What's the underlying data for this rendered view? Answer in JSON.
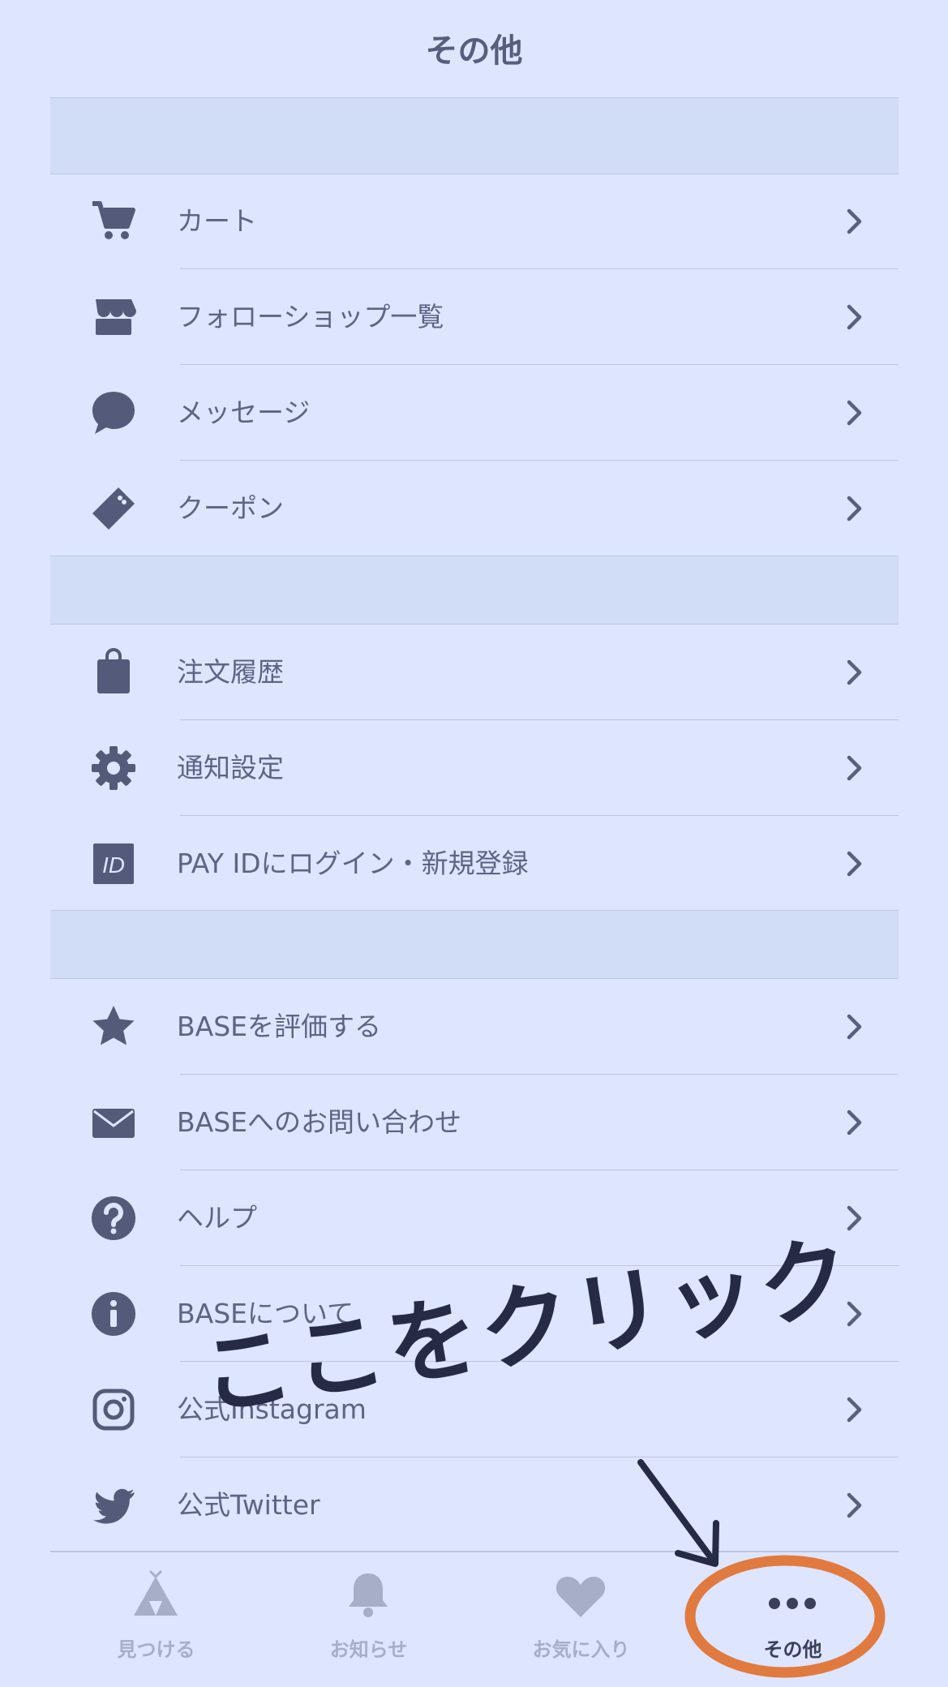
{
  "header": {
    "title": "その他"
  },
  "group1": [
    {
      "label": "カート",
      "icon": "cart-icon"
    },
    {
      "label": "フォローショップ一覧",
      "icon": "shop-icon"
    },
    {
      "label": "メッセージ",
      "icon": "message-icon"
    },
    {
      "label": "クーポン",
      "icon": "coupon-icon"
    }
  ],
  "group2": [
    {
      "label": "注文履歴",
      "icon": "bag-icon"
    },
    {
      "label": "通知設定",
      "icon": "gear-icon"
    },
    {
      "label": "PAY IDにログイン・新規登録",
      "icon": "id-icon",
      "icon_text": "ID"
    }
  ],
  "group3": [
    {
      "label": "BASEを評価する",
      "icon": "star-icon"
    },
    {
      "label": "BASEへのお問い合わせ",
      "icon": "mail-icon"
    },
    {
      "label": "ヘルプ",
      "icon": "help-icon"
    },
    {
      "label": "BASEについて",
      "icon": "info-icon"
    },
    {
      "label": "公式Instagram",
      "icon": "instagram-icon"
    },
    {
      "label": "公式Twitter",
      "icon": "twitter-icon"
    }
  ],
  "tabbar": {
    "tabs": [
      {
        "label": "見つける",
        "icon": "tent-icon",
        "active": false
      },
      {
        "label": "お知らせ",
        "icon": "bell-icon",
        "active": false
      },
      {
        "label": "お気に入り",
        "icon": "heart-icon",
        "active": false
      },
      {
        "label": "その他",
        "icon": "more-icon",
        "active": true
      }
    ]
  },
  "annotation": {
    "text": "ここをクリック"
  },
  "colors": {
    "background": "#dee5ff",
    "section_gap": "#d1dcf6",
    "icon": "#545a7a",
    "annotation_circle": "#e07a3f",
    "annotation_text": "#262b45"
  }
}
